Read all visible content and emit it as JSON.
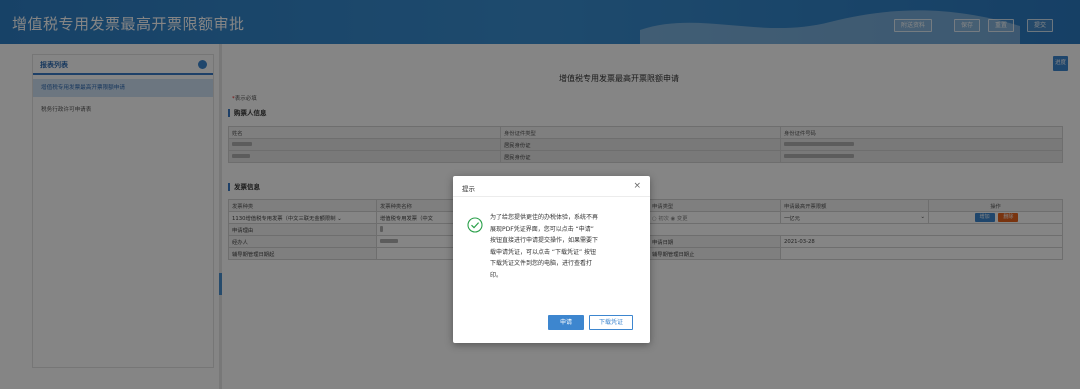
{
  "header": {
    "title": "增值税专用发票最高开票限额审批",
    "buttons": [
      "附送资料",
      "保存",
      "重置",
      "提交"
    ]
  },
  "sidebar": {
    "title": "报表列表",
    "items": [
      {
        "label": "增值税专用发票最高开票限额申请",
        "active": true
      },
      {
        "label": "税务行政许可申请表",
        "active": false
      }
    ]
  },
  "main": {
    "progress_label": "进度",
    "form_title": "增值税专用发票最高开票限额申请",
    "required_note": {
      "star": "*",
      "text": "表示必填"
    },
    "buyer_section": {
      "title": "购票人信息",
      "headers": [
        "姓名",
        "身份证件类型",
        "身份证件号码"
      ],
      "rows": [
        {
          "id_type": "居民身份证"
        },
        {
          "id_type": "居民身份证"
        }
      ]
    },
    "invoice_section": {
      "title": "发票信息",
      "headers": [
        "发票种类",
        "发票种类名称",
        "",
        "申请类型",
        "申请最高开票限额",
        "操作"
      ],
      "row": {
        "type": "1130增值税专用发票（中文三联无金额限制",
        "name": "增值税专用发票（中文",
        "apply_type_options": [
          "初次",
          "变更"
        ],
        "apply_type_selected": "变更",
        "limit": "一亿元",
        "add_label": "增加",
        "delete_label": "删除"
      },
      "reason_label": "申请理由",
      "handler_label": "经办人",
      "apply_date_label": "申请日期",
      "apply_date": "2021-03-28",
      "aux_start_label": "辅导期管理日期起",
      "aux_end_label": "辅导期管理日期止"
    }
  },
  "dialog": {
    "title": "提示",
    "close_symbol": "×",
    "message_lines": [
      "为了给您提供更佳的办税体验，系统不再",
      "展现PDF凭证界面，您可以点击 “申请”",
      "按钮直接进行申请提交操作，如果需要下",
      "载申请凭证，可以点击 “下载凭证” 按钮",
      "下载凭证文件到您的电脑，进行查看打",
      "印。"
    ],
    "apply_label": "申请",
    "download_label": "下载凭证"
  },
  "colors": {
    "header_blue": "#2d7fc6",
    "accent_blue": "#3d86cf",
    "danger_orange": "#e8641e",
    "success_green": "#2aa04a"
  }
}
